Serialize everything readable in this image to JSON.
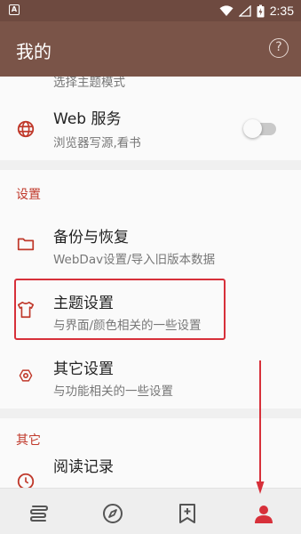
{
  "status_bar": {
    "time": "2:35"
  },
  "app_bar": {
    "title": "我的",
    "help_icon": "help-circle-icon",
    "help_label": "?"
  },
  "partial_item": {
    "subtitle": "选择主题模式"
  },
  "web_service": {
    "title": "Web 服务",
    "subtitle": "浏览器写源,看书",
    "icon": "globe-icon",
    "toggle_on": false
  },
  "settings_section": {
    "label": "设置",
    "items": [
      {
        "title": "备份与恢复",
        "subtitle": "WebDav设置/导入旧版本数据",
        "icon": "folder-icon"
      },
      {
        "title": "主题设置",
        "subtitle": "与界面/颜色相关的一些设置",
        "icon": "tshirt-icon"
      },
      {
        "title": "其它设置",
        "subtitle": "与功能相关的一些设置",
        "icon": "hexagon-settings-icon"
      }
    ]
  },
  "other_section": {
    "label": "其它",
    "items": [
      {
        "title": "阅读记录",
        "icon": "clock-icon"
      }
    ]
  },
  "bottom_nav": [
    "bookshelf-icon",
    "compass-icon",
    "bookmark-add-icon",
    "person-icon"
  ],
  "colors": {
    "app_bar": "#7a5448",
    "status_bar": "#6e4a40",
    "accent": "#c0392b",
    "highlight": "#d7303a"
  }
}
